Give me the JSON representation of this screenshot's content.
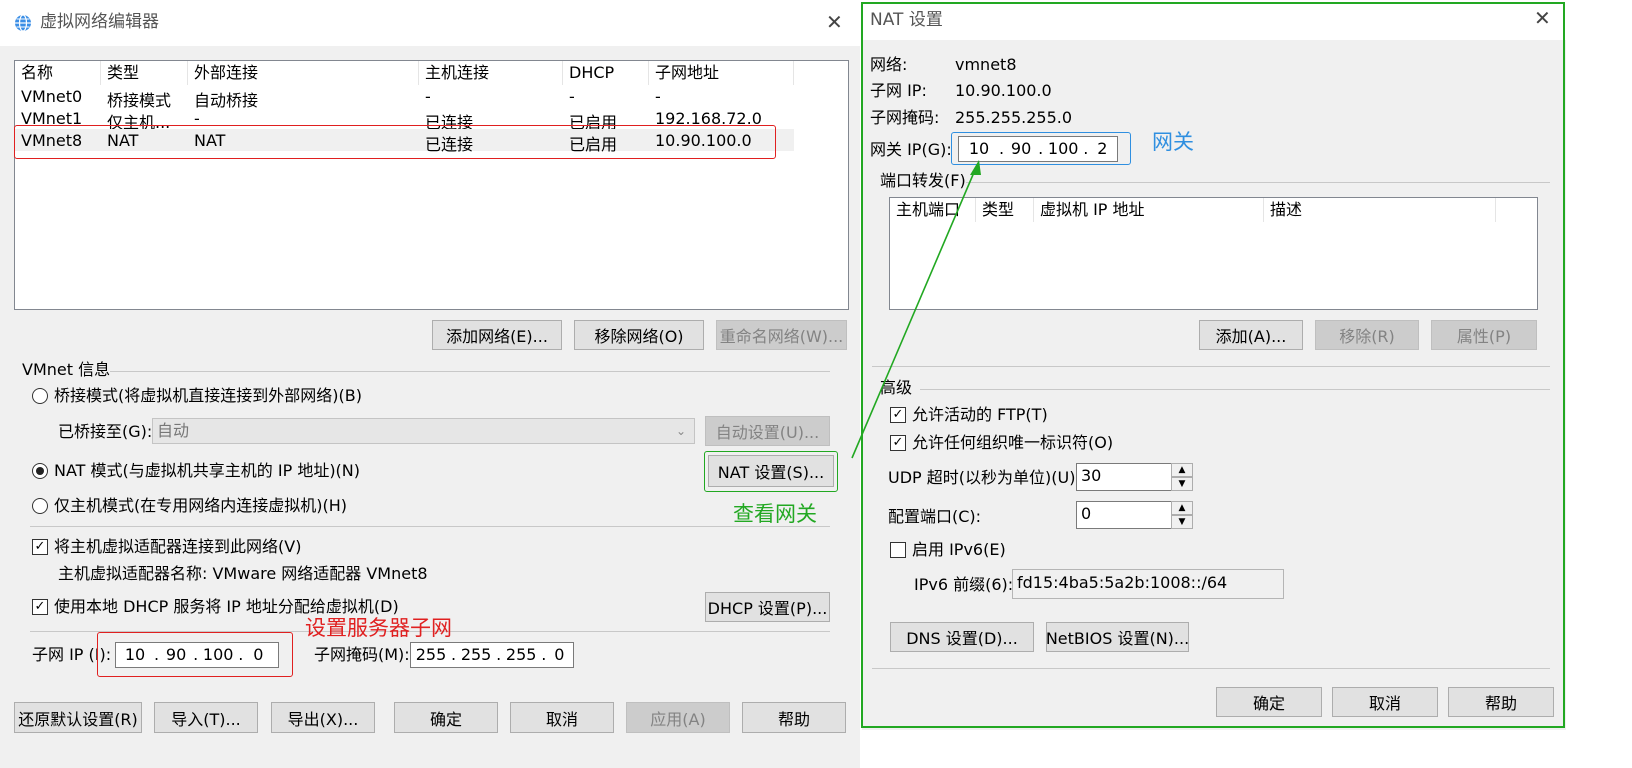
{
  "left_window": {
    "title": "虚拟网络编辑器",
    "close_glyph": "✕",
    "columns": [
      "名称",
      "类型",
      "外部连接",
      "主机连接",
      "DHCP",
      "子网地址"
    ],
    "rows": [
      [
        "VMnet0",
        "桥接模式",
        "自动桥接",
        "-",
        "-",
        "-"
      ],
      [
        "VMnet1",
        "仅主机...",
        "-",
        "已连接",
        "已启用",
        "192.168.72.0"
      ],
      [
        "VMnet8",
        "NAT",
        "NAT",
        "已连接",
        "已启用",
        "10.90.100.0"
      ]
    ],
    "add_network": "添加网络(E)...",
    "remove_network": "移除网络(O)",
    "rename_network": "重命名网络(W)...",
    "vmnet_info": "VMnet 信息",
    "bridge_mode": "桥接模式(将虚拟机直接连接到外部网络)(B)",
    "bridged_to_label": "已桥接至(G):",
    "bridged_to_value": "自动",
    "auto_settings": "自动设置(U)...",
    "nat_mode": "NAT 模式(与虚拟机共享主机的 IP 地址)(N)",
    "nat_settings": "NAT 设置(S)...",
    "host_only": "仅主机模式(在专用网络内连接虚拟机)(H)",
    "connect_adapter": "将主机虚拟适配器连接到此网络(V)",
    "adapter_name": "主机虚拟适配器名称: VMware 网络适配器 VMnet8",
    "use_dhcp": "使用本地 DHCP 服务将 IP 地址分配给虚拟机(D)",
    "dhcp_settings": "DHCP 设置(P)...",
    "subnet_ip_label": "子网 IP (I):",
    "subnet_ip": [
      "10",
      "90",
      "100",
      "0"
    ],
    "subnet_mask_label": "子网掩码(M):",
    "subnet_mask": [
      "255",
      "255",
      "255",
      "0"
    ],
    "restore_defaults": "还原默认设置(R)",
    "import": "导入(T)...",
    "export": "导出(X)...",
    "ok": "确定",
    "cancel": "取消",
    "apply": "应用(A)",
    "help": "帮助"
  },
  "right_window": {
    "title": "NAT 设置",
    "close_glyph": "✕",
    "network_label": "网络:",
    "network_value": "vmnet8",
    "subnet_ip_label": "子网 IP:",
    "subnet_ip_value": "10.90.100.0",
    "subnet_mask_label": "子网掩码:",
    "subnet_mask_value": "255.255.255.0",
    "gateway_label": "网关 IP(G):",
    "gateway_ip": [
      "10",
      "90",
      "100",
      "2"
    ],
    "port_forwarding": "端口转发(F)",
    "pf_columns": [
      "主机端口",
      "类型",
      "虚拟机 IP 地址",
      "描述"
    ],
    "add": "添加(A)...",
    "remove": "移除(R)",
    "properties": "属性(P)",
    "advanced": "高级",
    "allow_ftp": "允许活动的 FTP(T)",
    "allow_oui": "允许任何组织唯一标识符(O)",
    "udp_timeout_label": "UDP 超时(以秒为单位)(U):",
    "udp_timeout_value": "30",
    "config_port_label": "配置端口(C):",
    "config_port_value": "0",
    "enable_ipv6": "启用 IPv6(E)",
    "ipv6_prefix_label": "IPv6 前缀(6):",
    "ipv6_prefix_value": "fd15:4ba5:5a2b:1008::/64",
    "dns_settings": "DNS 设置(D)...",
    "netbios_settings": "NetBIOS 设置(N)...",
    "ok": "确定",
    "cancel": "取消",
    "help": "帮助"
  },
  "annotations": {
    "set_subnet": "设置服务器子网",
    "view_gateway": "查看网关",
    "gateway": "网关",
    "red": "#e02020",
    "green": "#22a822",
    "blue": "#2f8fe0"
  }
}
